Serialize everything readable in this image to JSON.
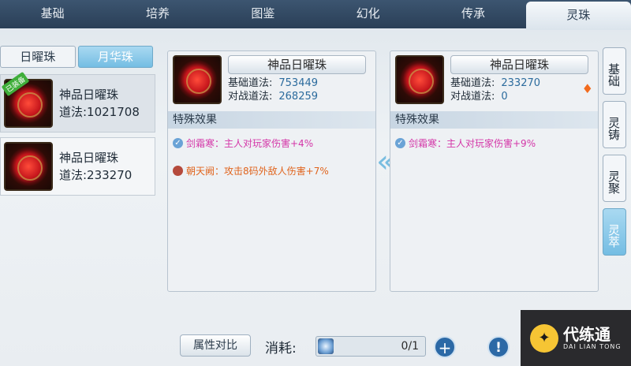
{
  "top_tabs": [
    "基础",
    "培养",
    "图鉴",
    "幻化",
    "传承",
    "灵珠"
  ],
  "sub_tabs": [
    "日曜珠",
    "月华珠"
  ],
  "list_items": [
    {
      "name": "神品日曜珠",
      "power": "道法:1021708",
      "badge": "已装备"
    },
    {
      "name": "神品日曜珠",
      "power": "道法:233270",
      "badge": ""
    }
  ],
  "panel_left": {
    "name": "神品日曜珠",
    "base_label": "基础道法:",
    "base_value": "753449",
    "battle_label": "对战道法:",
    "battle_value": "268259",
    "section": "特殊效果",
    "effect1": "剑霜寒：主人对玩家伤害+4%",
    "effect2": "朝天阙：攻击8码外敌人伤害+7%"
  },
  "panel_right": {
    "name": "神品日曜珠",
    "base_label": "基础道法:",
    "base_value": "233270",
    "battle_label": "对战道法:",
    "battle_value": "0",
    "section": "特殊效果",
    "effect1": "剑霜寒：主人对玩家伤害+9%"
  },
  "side_tabs": [
    "基础",
    "灵铸",
    "灵聚",
    "灵萃"
  ],
  "bottom": {
    "compare_label": "属性对比",
    "cost_label": "消耗:",
    "cost_value": "0/1",
    "add_label": "+",
    "info_label": "!"
  },
  "watermark": {
    "cn": "代练通",
    "en": "DAI LIAN TONG"
  },
  "colors": {
    "accent": "#74bde3",
    "effect_pink": "#d436a8",
    "effect_orange": "#e0641d",
    "stat_blue": "#2b6b9d"
  }
}
